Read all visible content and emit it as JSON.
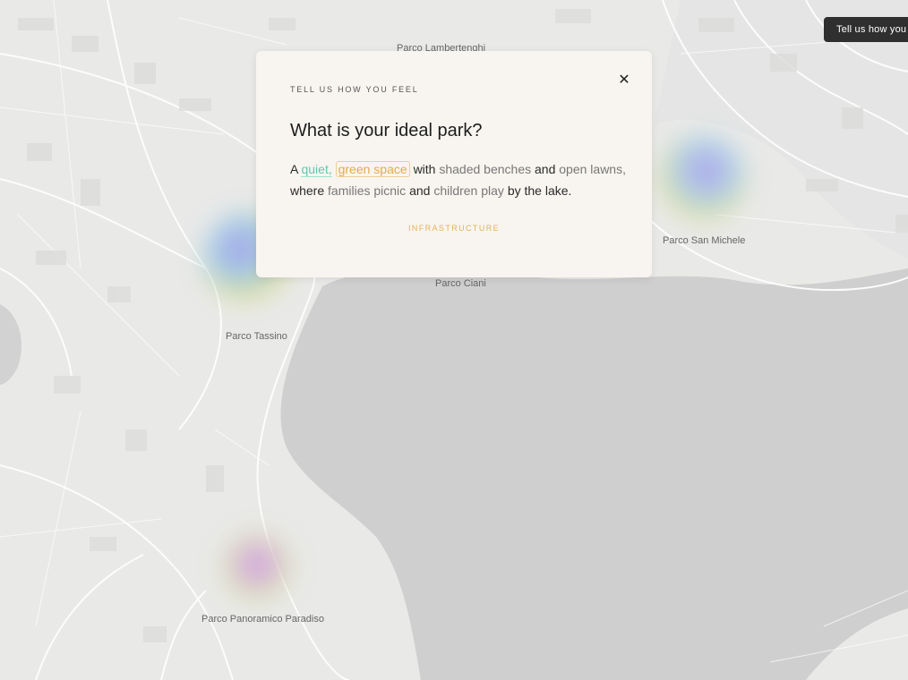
{
  "map": {
    "parks": [
      {
        "name": "Parco Lambertenghi"
      },
      {
        "name": "Parco San Michele"
      },
      {
        "name": "Parco Ciani"
      },
      {
        "name": "Parco Tassino"
      },
      {
        "name": "Parco Panoramico Paradiso"
      }
    ]
  },
  "header": {
    "cta_label": "Tell us how you"
  },
  "modal": {
    "kicker": "TELL US HOW YOU FEEL",
    "close_icon": "close-icon",
    "title": "What is your ideal park?",
    "sentence": {
      "w_a": "A",
      "t_quiet": "quiet,",
      "t_green": "green space",
      "w_with": "with",
      "t_benches": "shaded benches",
      "w_and1": "and",
      "t_lawns": "open lawns,",
      "w_where": "where",
      "t_families": "families picnic",
      "w_and2": "and",
      "t_children": "children play",
      "w_lake": "by the lake."
    },
    "category": "INFRASTRUCTURE"
  },
  "colors": {
    "accent_green": "#5fc7b0",
    "accent_orange": "#e6a94b",
    "modal_bg": "#f8f5f0"
  }
}
